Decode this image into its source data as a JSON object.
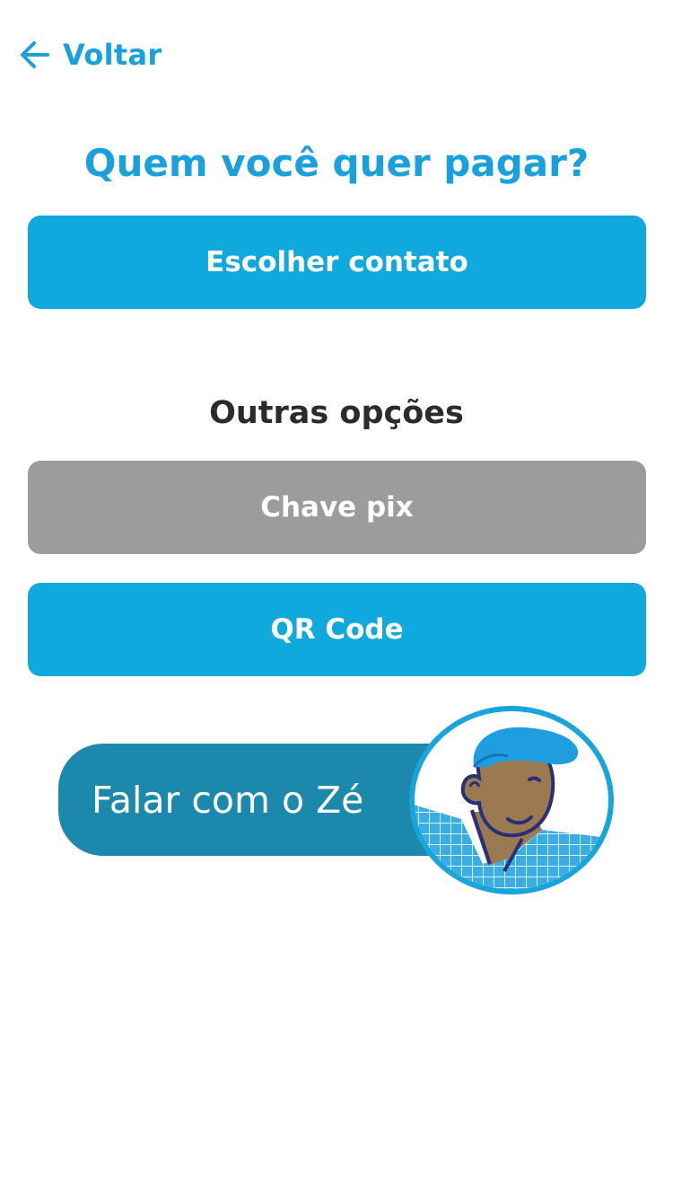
{
  "header": {
    "back_label": "Voltar",
    "back_icon": "arrow-left-icon"
  },
  "page": {
    "title": "Quem você quer pagar?",
    "choose_contact_label": "Escolher contato",
    "other_options_label": "Outras opções"
  },
  "options": {
    "pix_label": "Chave pix",
    "qr_label": "QR Code"
  },
  "assistant": {
    "chat_label": "Falar com o Zé",
    "avatar_icon": "ze-avatar-icon"
  },
  "colors": {
    "accent": "#0fa9dd",
    "title": "#1aa0dc",
    "disabled": "#9c9c9c",
    "chat": "#1c88ac",
    "text_dark": "#2b2b2b"
  }
}
